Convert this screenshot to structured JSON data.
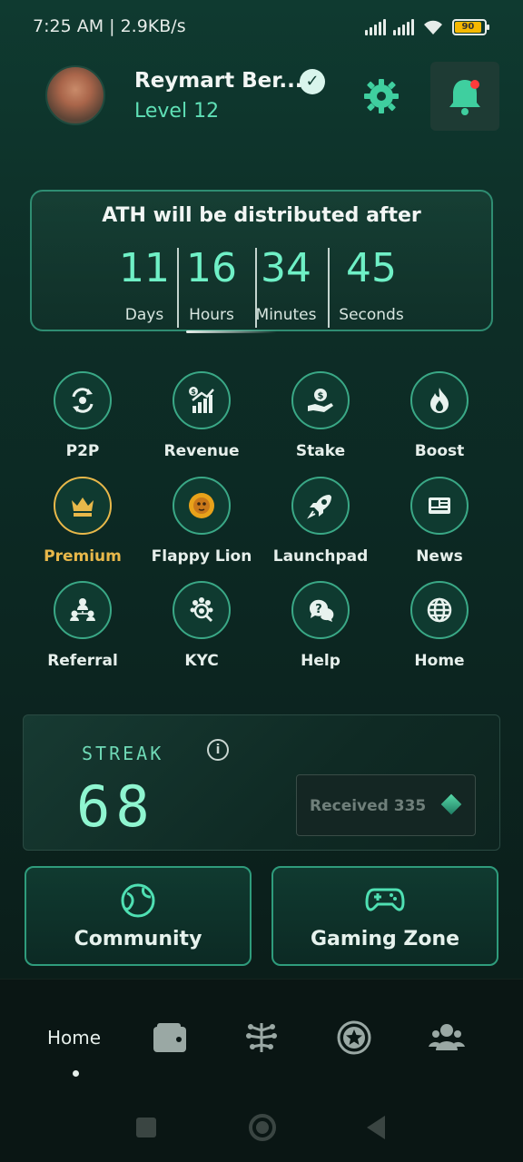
{
  "status_bar": {
    "time": "7:25 AM | 2.9KB/s",
    "battery": "90"
  },
  "profile": {
    "name": "Reymart Ber...",
    "level": "Level 12"
  },
  "countdown": {
    "title": "ATH will be distributed after",
    "units": [
      {
        "value": "11",
        "label": "Days"
      },
      {
        "value": "16",
        "label": "Hours"
      },
      {
        "value": "34",
        "label": "Minutes"
      },
      {
        "value": "45",
        "label": "Seconds"
      }
    ]
  },
  "menu": [
    {
      "label": "P2P",
      "icon": "p2p-icon"
    },
    {
      "label": "Revenue",
      "icon": "revenue-icon"
    },
    {
      "label": "Stake",
      "icon": "stake-icon"
    },
    {
      "label": "Boost",
      "icon": "boost-icon"
    },
    {
      "label": "Premium",
      "icon": "crown-icon"
    },
    {
      "label": "Flappy Lion",
      "icon": "lion-icon"
    },
    {
      "label": "Launchpad",
      "icon": "rocket-icon"
    },
    {
      "label": "News",
      "icon": "news-icon"
    },
    {
      "label": "Referral",
      "icon": "referral-icon"
    },
    {
      "label": "KYC",
      "icon": "kyc-icon"
    },
    {
      "label": "Help",
      "icon": "help-icon"
    },
    {
      "label": "Home",
      "icon": "globe-icon"
    }
  ],
  "streak": {
    "title": "STREAK",
    "value": "68",
    "received": "Received 335"
  },
  "actions": {
    "community": "Community",
    "gaming": "Gaming Zone"
  },
  "bottom_nav": {
    "home": "Home"
  },
  "colors": {
    "accent": "#6ff0c6",
    "premium": "#e8b84a",
    "border": "#2f8d72"
  }
}
